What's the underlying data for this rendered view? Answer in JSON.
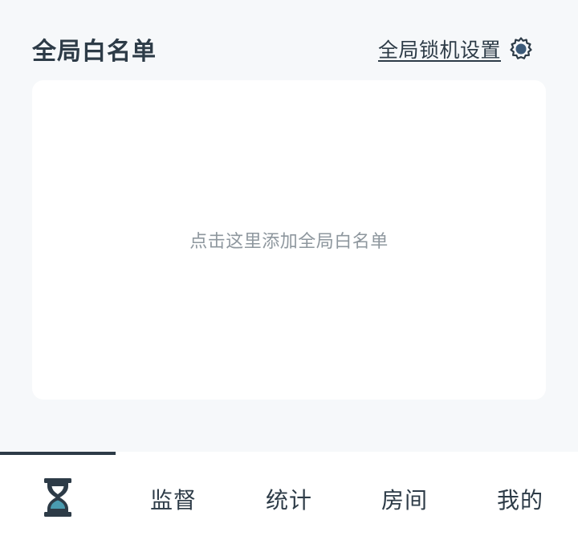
{
  "header": {
    "title": "全局白名单",
    "settings_label": "全局锁机设置",
    "settings_icon": "gear-icon"
  },
  "whitelist_card": {
    "hint": "点击这里添加全局白名单"
  },
  "tabbar": {
    "active_index": 0,
    "active_color": "#2d3b47",
    "icon_accent": "#4a9bb0",
    "tabs": [
      {
        "icon": "hourglass-icon",
        "label": ""
      },
      {
        "label": "监督"
      },
      {
        "label": "统计"
      },
      {
        "label": "房间"
      },
      {
        "label": "我的"
      }
    ]
  }
}
